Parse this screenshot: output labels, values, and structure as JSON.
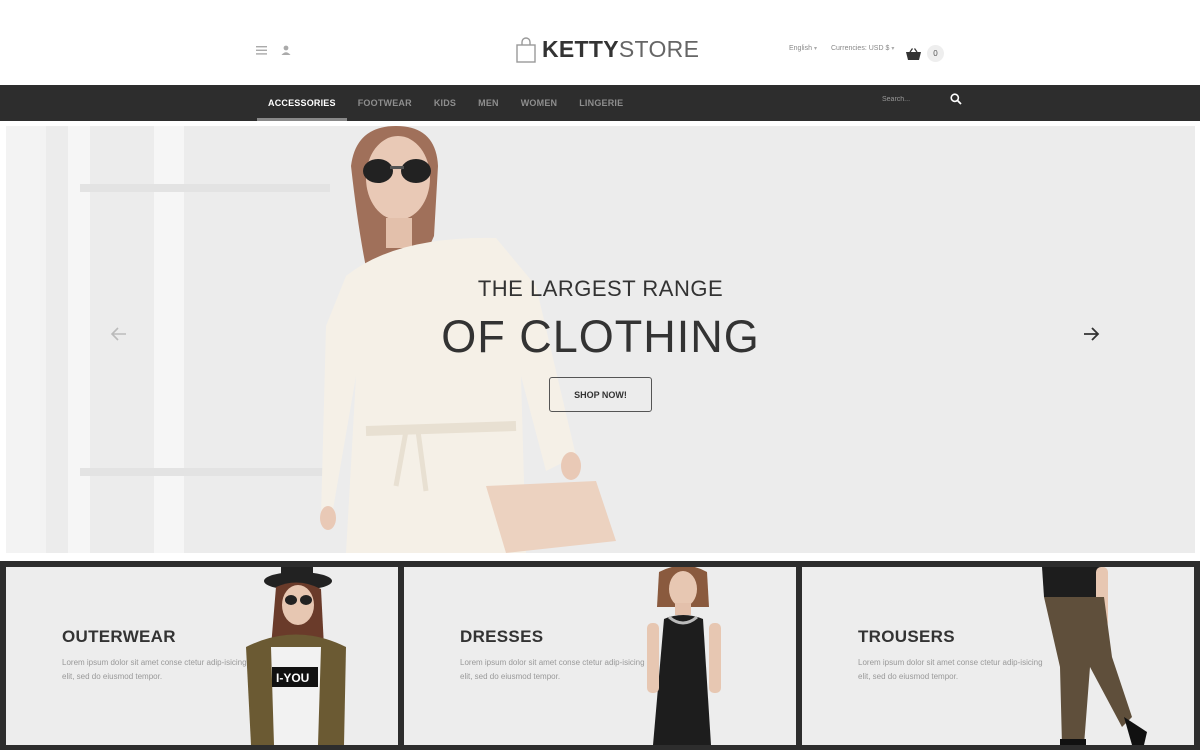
{
  "header": {
    "logo_bold": "KETTY",
    "logo_light": "STORE",
    "language": "English",
    "currency": "Currencies: USD $",
    "cart_count": "0"
  },
  "nav": {
    "items": [
      "ACCESSORIES",
      "FOOTWEAR",
      "KIDS",
      "MEN",
      "WOMEN",
      "LINGERIE"
    ],
    "active": "ACCESSORIES",
    "search_placeholder": "Search..."
  },
  "hero": {
    "line1": "THE LARGEST RANGE",
    "line2": "OF CLOTHING",
    "button": "SHOP NOW!"
  },
  "categories": [
    {
      "title": "OUTERWEAR",
      "text": "Lorem ipsum dolor sit amet conse ctetur adip-isicing elit, sed do eiusmod tempor."
    },
    {
      "title": "DRESSES",
      "text": "Lorem ipsum dolor sit amet conse ctetur adip-isicing elit, sed do eiusmod tempor."
    },
    {
      "title": "TROUSERS",
      "text": "Lorem ipsum dolor sit amet conse ctetur adip-isicing elit, sed do eiusmod tempor."
    }
  ],
  "colors": {
    "nav_bg": "#2d2d2d",
    "hero_bg": "#ececec",
    "text_dark": "#333333"
  },
  "icons": {
    "menu": "hamburger-icon",
    "account": "user-icon",
    "bag": "shopping-bag-icon",
    "cart": "basket-icon",
    "search": "search-icon",
    "prev": "arrow-left-icon",
    "next": "arrow-right-icon"
  }
}
